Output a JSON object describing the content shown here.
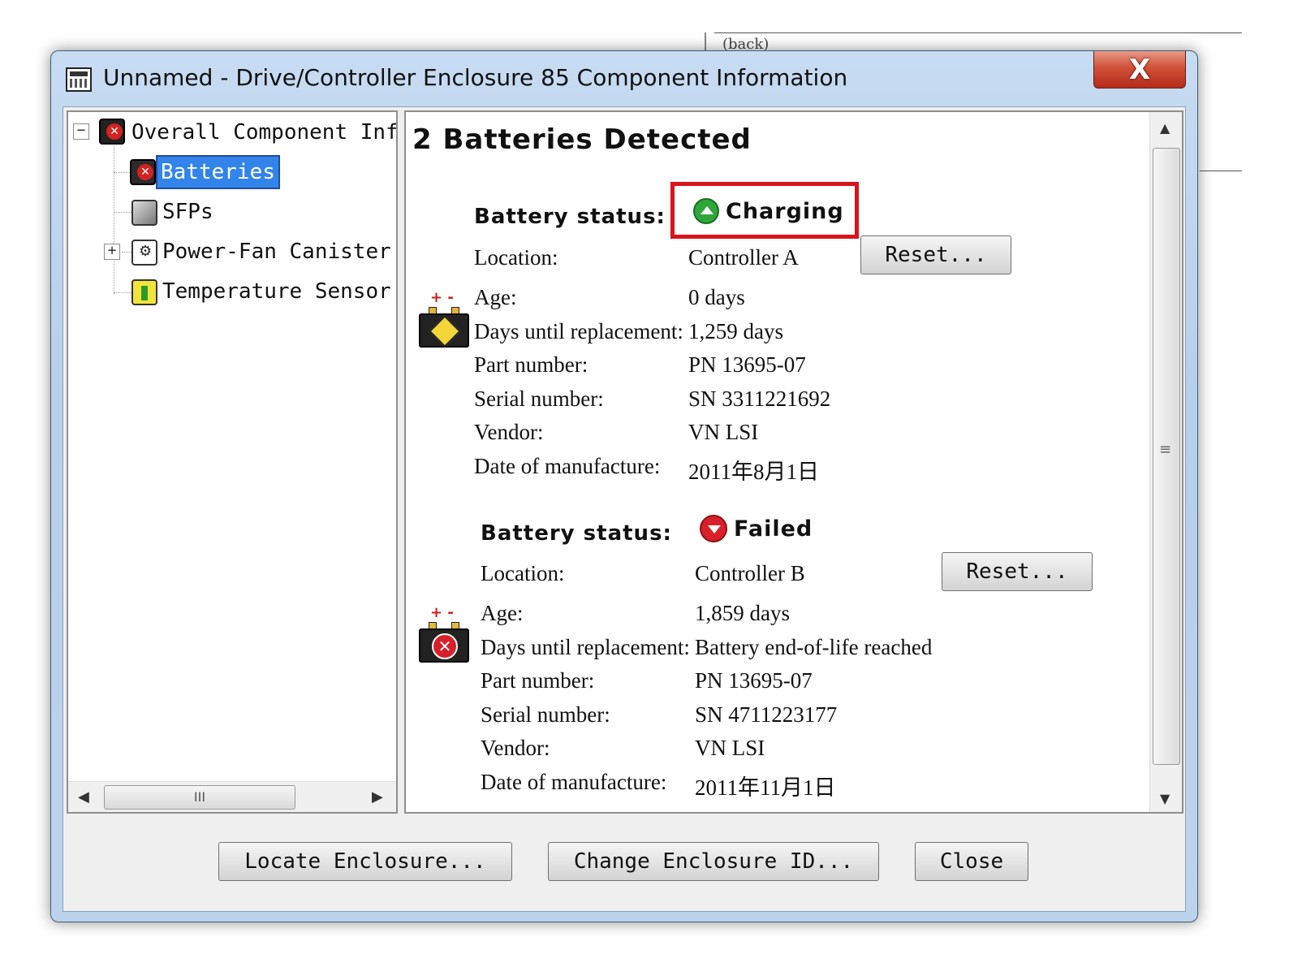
{
  "background": {
    "text": "(back)"
  },
  "window": {
    "title": "Unnamed - Drive/Controller Enclosure 85 Component Information",
    "close_label": "X"
  },
  "tree": {
    "items": [
      {
        "label": "Overall Component Inf",
        "icon": "overall-component-icon",
        "expander": "−"
      },
      {
        "label": "Batteries",
        "icon": "battery-icon",
        "selected": true
      },
      {
        "label": "SFPs",
        "icon": "sfp-icon"
      },
      {
        "label": "Power-Fan Canister",
        "icon": "power-fan-icon",
        "expander": "+"
      },
      {
        "label": "Temperature Sensor:",
        "icon": "temperature-sensor-icon"
      }
    ],
    "scroll_grip": "III"
  },
  "detail": {
    "title": "2 Batteries Detected",
    "batteries": [
      {
        "status_label": "Battery status:",
        "status": "Charging",
        "status_color": "#2fa63a",
        "reset_label": "Reset...",
        "props": [
          {
            "label": "Location:",
            "value": "Controller A"
          },
          {
            "label": "Age:",
            "value": "0 days"
          },
          {
            "label": "Days until replacement:",
            "value": "1,259 days"
          },
          {
            "label": "Part number:",
            "value": "PN 13695-07"
          },
          {
            "label": "Serial number:",
            "value": "SN 3311221692"
          },
          {
            "label": "Vendor:",
            "value": "VN LSI"
          },
          {
            "label": "Date of manufacture:",
            "value": "2011年8月1日"
          }
        ]
      },
      {
        "status_label": "Battery status:",
        "status": "Failed",
        "status_color": "#d8202a",
        "reset_label": "Reset...",
        "props": [
          {
            "label": "Location:",
            "value": "Controller B"
          },
          {
            "label": "Age:",
            "value": "1,859 days"
          },
          {
            "label": "Days until replacement:",
            "value": "Battery end-of-life reached"
          },
          {
            "label": "Part number:",
            "value": "PN 13695-07"
          },
          {
            "label": "Serial number:",
            "value": "SN 4711223177"
          },
          {
            "label": "Vendor:",
            "value": "VN LSI"
          },
          {
            "label": "Date of manufacture:",
            "value": "2011年11月1日"
          }
        ]
      }
    ]
  },
  "buttons": {
    "locate": "Locate Enclosure...",
    "change_id": "Change Enclosure ID...",
    "close": "Close"
  },
  "highlight_color": "#d8141c"
}
